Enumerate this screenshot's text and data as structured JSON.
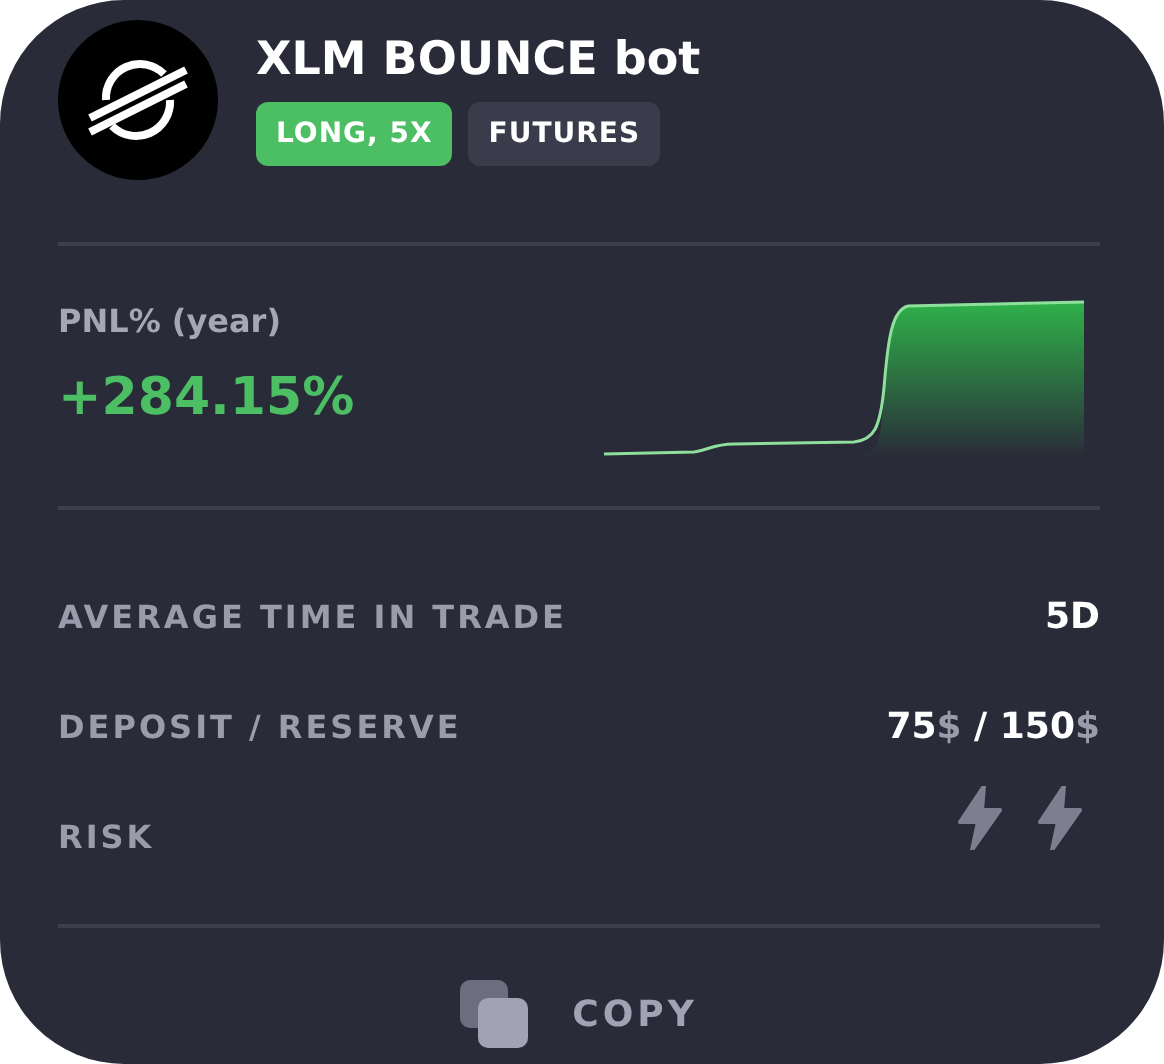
{
  "bot": {
    "title": "XLM BOUNCE bot",
    "tags": [
      {
        "label": "LONG, 5X",
        "color": "#4cbe63"
      },
      {
        "label": "FUTURES",
        "color": "#3a3c4b"
      }
    ]
  },
  "pnl": {
    "label": "PNL% (year)",
    "value": "+284.15%"
  },
  "stats": [
    {
      "kind": "text",
      "label": "AVERAGE TIME IN TRADE",
      "value": [
        {
          "text": "5D",
          "kind": "number"
        }
      ]
    },
    {
      "kind": "text",
      "label": "DEPOSIT / RESERVE",
      "value": [
        {
          "text": "75",
          "kind": "number"
        },
        {
          "text": "$",
          "kind": "unit"
        },
        {
          "text": " / 150",
          "kind": "number"
        },
        {
          "text": "$",
          "kind": "unit"
        }
      ]
    },
    {
      "kind": "icons",
      "label": "RISK",
      "icons": [
        {
          "kind": "bolt"
        },
        {
          "kind": "bolt"
        }
      ]
    }
  ],
  "copy_button": {
    "label": "COPY"
  }
}
